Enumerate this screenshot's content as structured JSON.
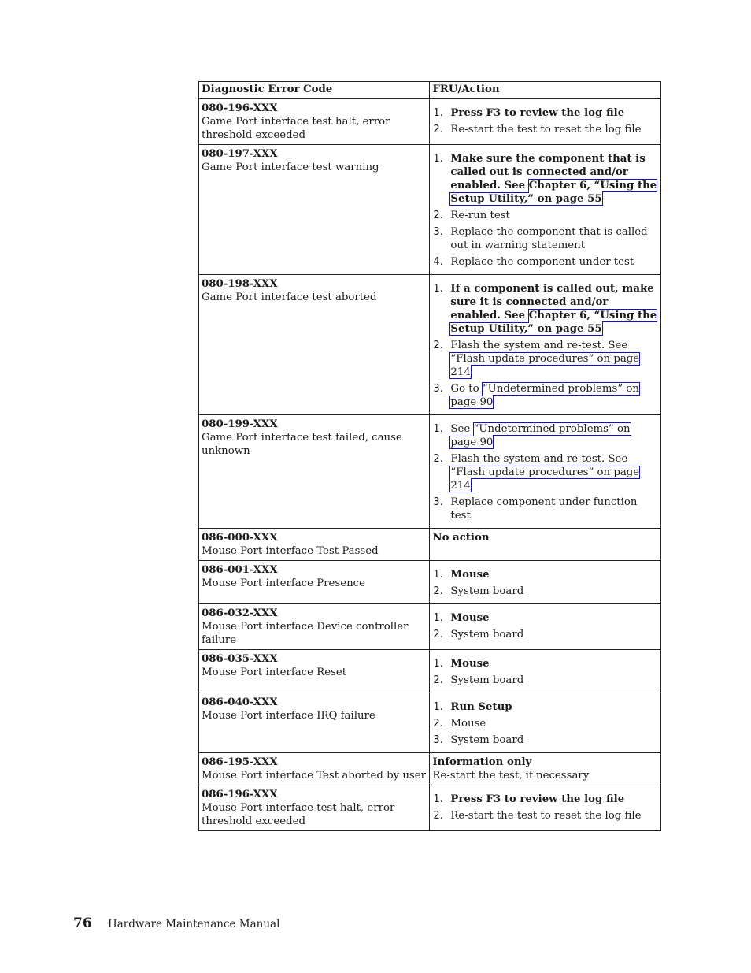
{
  "table": {
    "headers": [
      "Diagnostic Error Code",
      "FRU/Action"
    ],
    "rows": [
      {
        "code": "080-196-XXX",
        "desc": "Game Port interface test halt, error threshold exceeded",
        "actions": [
          {
            "num": "1.",
            "parts": [
              {
                "text": "Press F3 to review the log file",
                "bold": true
              }
            ]
          },
          {
            "num": "2.",
            "parts": [
              {
                "text": "Re-start the test to reset the log file"
              }
            ]
          }
        ]
      },
      {
        "code": "080-197-XXX",
        "desc": "Game Port interface test warning",
        "actions": [
          {
            "num": "1.",
            "parts": [
              {
                "text": "Make sure the component that is called out is connected and/or enabled. See ",
                "bold": true
              },
              {
                "text": "Chapter 6, “Using the Setup Utility,” on page 55",
                "bold": true,
                "link": true
              }
            ]
          },
          {
            "num": "2.",
            "parts": [
              {
                "text": "Re-run test"
              }
            ]
          },
          {
            "num": "3.",
            "parts": [
              {
                "text": "Replace the component that is called out in warning statement"
              }
            ]
          },
          {
            "num": "4.",
            "parts": [
              {
                "text": "Replace the component under test"
              }
            ]
          }
        ]
      },
      {
        "code": "080-198-XXX",
        "desc": "Game Port interface test aborted",
        "actions": [
          {
            "num": "1.",
            "parts": [
              {
                "text": "If a component is called out, make sure it is connected and/or enabled. See ",
                "bold": true
              },
              {
                "text": "Chapter 6, “Using the Setup Utility,” on page 55",
                "bold": true,
                "link": true
              }
            ]
          },
          {
            "num": "2.",
            "parts": [
              {
                "text": "Flash the system and re-test. See "
              },
              {
                "text": "“Flash update procedures” on page 214",
                "link": true
              }
            ]
          },
          {
            "num": "3.",
            "parts": [
              {
                "text": "Go to "
              },
              {
                "text": "“Undetermined problems” on page 90",
                "link": true
              }
            ]
          }
        ]
      },
      {
        "code": "080-199-XXX",
        "desc": "Game Port interface test failed, cause unknown",
        "actions": [
          {
            "num": "1.",
            "parts": [
              {
                "text": "See "
              },
              {
                "text": "“Undetermined problems” on page 90",
                "link": true
              }
            ]
          },
          {
            "num": "2.",
            "parts": [
              {
                "text": "Flash the system and re-test. See "
              },
              {
                "text": "“Flash update procedures” on page 214",
                "link": true
              }
            ]
          },
          {
            "num": "3.",
            "parts": [
              {
                "text": "Replace component under function test"
              }
            ]
          }
        ]
      },
      {
        "code": "086-000-XXX",
        "desc": "Mouse Port interface Test Passed",
        "plain": [
          {
            "text": "No action",
            "bold": true
          }
        ]
      },
      {
        "code": "086-001-XXX",
        "desc": "Mouse Port interface Presence",
        "actions": [
          {
            "num": "1.",
            "parts": [
              {
                "text": "Mouse",
                "bold": true
              }
            ]
          },
          {
            "num": "2.",
            "parts": [
              {
                "text": "System board"
              }
            ]
          }
        ]
      },
      {
        "code": "086-032-XXX",
        "desc": "Mouse Port interface Device controller failure",
        "actions": [
          {
            "num": "1.",
            "parts": [
              {
                "text": "Mouse",
                "bold": true
              }
            ]
          },
          {
            "num": "2.",
            "parts": [
              {
                "text": "System board"
              }
            ]
          }
        ]
      },
      {
        "code": "086-035-XXX",
        "desc": "Mouse Port interface Reset",
        "actions": [
          {
            "num": "1.",
            "parts": [
              {
                "text": "Mouse",
                "bold": true
              }
            ]
          },
          {
            "num": "2.",
            "parts": [
              {
                "text": "System board"
              }
            ]
          }
        ]
      },
      {
        "code": "086-040-XXX",
        "desc": "Mouse Port interface IRQ failure",
        "actions": [
          {
            "num": "1.",
            "parts": [
              {
                "text": "Run Setup",
                "bold": true
              }
            ]
          },
          {
            "num": "2.",
            "parts": [
              {
                "text": "Mouse"
              }
            ]
          },
          {
            "num": "3.",
            "parts": [
              {
                "text": "System board"
              }
            ]
          }
        ]
      },
      {
        "code": "086-195-XXX",
        "desc": "Mouse Port interface Test aborted by user",
        "plain": [
          {
            "text": "Information only",
            "bold": true
          },
          {
            "text": "Re-start the test, if necessary"
          }
        ]
      },
      {
        "code": "086-196-XXX",
        "desc": "Mouse Port interface test halt, error threshold exceeded",
        "actions": [
          {
            "num": "1.",
            "parts": [
              {
                "text": "Press F3 to review the log file",
                "bold": true
              }
            ]
          },
          {
            "num": "2.",
            "parts": [
              {
                "text": "Re-start the test to reset the log file"
              }
            ]
          }
        ]
      }
    ]
  },
  "footer": {
    "page_number": "76",
    "title": "Hardware Maintenance Manual"
  }
}
